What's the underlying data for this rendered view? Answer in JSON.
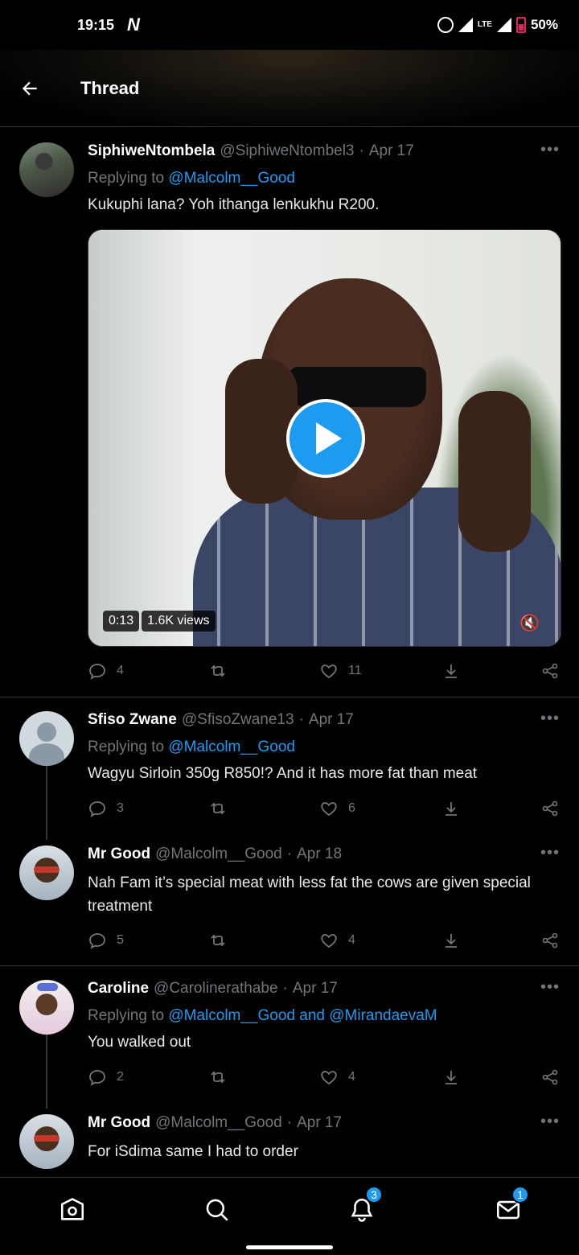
{
  "status_bar": {
    "time": "19:15",
    "app_badge": "N",
    "network": "LTE",
    "battery": "50%"
  },
  "header": {
    "title": "Thread"
  },
  "tweets": [
    {
      "name": "SiphiweNtombela",
      "handle": "@SiphiweNtombel3",
      "date": "Apr 17",
      "replying_prefix": "Replying to",
      "replying_to": "@Malcolm__Good",
      "text": "Kukuphi lana? Yoh ithanga lenkukhu R200.",
      "media": {
        "duration": "0:13",
        "views": "1.6K views"
      },
      "replies": "4",
      "retweets": "",
      "likes": "11"
    },
    {
      "name": "Sfiso Zwane",
      "handle": "@SfisoZwane13",
      "date": "Apr 17",
      "replying_prefix": "Replying to",
      "replying_to": "@Malcolm__Good",
      "text": "Wagyu Sirloin 350g R850!? And it has more fat than meat",
      "replies": "3",
      "retweets": "",
      "likes": "6"
    },
    {
      "name": "Mr Good",
      "handle": "@Malcolm__Good",
      "date": "Apr 18",
      "text": "Nah Fam it’s special meat with less fat the cows are given special treatment",
      "replies": "5",
      "retweets": "",
      "likes": "4"
    },
    {
      "name": "Caroline",
      "handle": "@Carolinerathabe",
      "date": "Apr 17",
      "replying_prefix": "Replying to",
      "replying_to": "@Malcolm__Good and @MirandaevaM",
      "text": "You walked out",
      "replies": "2",
      "retweets": "",
      "likes": "4"
    },
    {
      "name": "Mr Good",
      "handle": "@Malcolm__Good",
      "date": "Apr 17",
      "text": "For iSdima same I had to order"
    }
  ],
  "bottom_nav": {
    "notifications_badge": "3",
    "messages_badge": "1"
  },
  "colors": {
    "accent": "#1d9bf0",
    "background": "#000000",
    "muted": "#71767b"
  }
}
